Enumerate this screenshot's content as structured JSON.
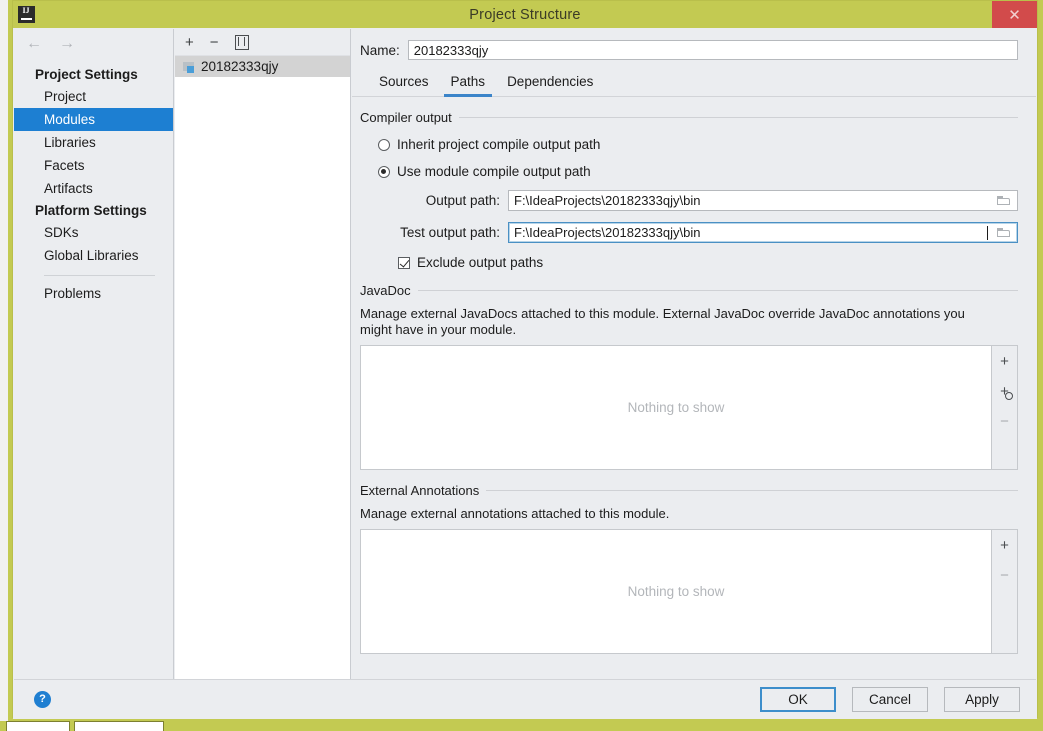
{
  "window": {
    "title": "Project Structure",
    "app_icon": "intellij-idea-icon",
    "close_label": "✕"
  },
  "nav": {
    "back_icon": "arrow-left-icon",
    "forward_icon": "arrow-right-icon",
    "groups": [
      {
        "label": "Project Settings",
        "items": [
          {
            "label": "Project",
            "selected": false
          },
          {
            "label": "Modules",
            "selected": true
          },
          {
            "label": "Libraries",
            "selected": false
          },
          {
            "label": "Facets",
            "selected": false
          },
          {
            "label": "Artifacts",
            "selected": false
          }
        ]
      },
      {
        "label": "Platform Settings",
        "items": [
          {
            "label": "SDKs",
            "selected": false
          },
          {
            "label": "Global Libraries",
            "selected": false
          }
        ]
      }
    ],
    "problems_label": "Problems"
  },
  "module_list": {
    "toolbar": {
      "add_label": "+",
      "remove_label": "−",
      "copy_icon": "copy-icon"
    },
    "modules": [
      {
        "name": "20182333qjy",
        "selected": true
      }
    ]
  },
  "module_editor": {
    "name_label": "Name:",
    "name_value": "20182333qjy",
    "tabs": [
      {
        "label": "Sources",
        "active": false
      },
      {
        "label": "Paths",
        "active": true
      },
      {
        "label": "Dependencies",
        "active": false
      }
    ],
    "compiler_output": {
      "section_title": "Compiler output",
      "inherit_option": "Inherit project compile output path",
      "inherit_selected": false,
      "module_option": "Use module compile output path",
      "module_selected": true,
      "output_path_label": "Output path:",
      "output_path_value": "F:\\IdeaProjects\\20182333qjy\\bin",
      "test_output_path_label": "Test output path:",
      "test_output_path_value": "F:\\IdeaProjects\\20182333qjy\\bin",
      "test_output_focused": true,
      "browse_icon": "folder-browse-icon",
      "exclude_label": "Exclude output paths",
      "exclude_checked": true
    },
    "javadoc": {
      "section_title": "JavaDoc",
      "description": "Manage external JavaDocs attached to this module. External JavaDoc override JavaDoc annotations you might have in your module.",
      "empty_text": "Nothing to show",
      "buttons": [
        {
          "icon": "plus-icon",
          "label": "+"
        },
        {
          "icon": "plus-url-icon",
          "label": "+"
        },
        {
          "icon": "minus-icon",
          "label": "−"
        }
      ]
    },
    "external_annotations": {
      "section_title": "External Annotations",
      "description": "Manage external annotations attached to this module.",
      "empty_text": "Nothing to show",
      "buttons": [
        {
          "icon": "plus-icon",
          "label": "+"
        },
        {
          "icon": "minus-icon",
          "label": "−"
        }
      ]
    }
  },
  "footer": {
    "help_label": "?",
    "ok_label": "OK",
    "cancel_label": "Cancel",
    "apply_label": "Apply"
  },
  "colors": {
    "titlebar": "#c3ca52",
    "accent_blue": "#1d7fd2",
    "close_red": "#d24b4b",
    "tab_underline": "#3b84c9",
    "focus_border": "#4a90c4"
  }
}
